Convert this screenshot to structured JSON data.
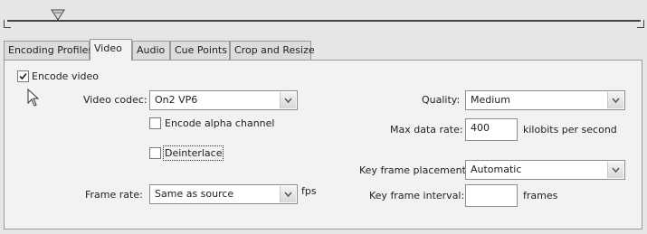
{
  "tabs": [
    {
      "label": "Encoding Profiles"
    },
    {
      "label": "Video"
    },
    {
      "label": "Audio"
    },
    {
      "label": "Cue Points"
    },
    {
      "label": "Crop and Resize"
    }
  ],
  "active_tab": "Video",
  "encode_video": {
    "label": "Encode video",
    "checked": true
  },
  "video_codec": {
    "label": "Video codec:",
    "value": "On2 VP6"
  },
  "encode_alpha": {
    "label": "Encode alpha channel",
    "checked": false
  },
  "deinterlace": {
    "label": "Deinterlace",
    "checked": false
  },
  "frame_rate": {
    "label": "Frame rate:",
    "value": "Same as source",
    "unit": "fps"
  },
  "quality": {
    "label": "Quality:",
    "value": "Medium"
  },
  "max_data_rate": {
    "label": "Max data rate:",
    "value": "400",
    "unit": "kilobits per second"
  },
  "key_frame_placement": {
    "label": "Key frame placement:",
    "value": "Automatic"
  },
  "key_frame_interval": {
    "label": "Key frame interval:",
    "value": "",
    "unit": "frames"
  },
  "icons": {
    "timeline_playhead": "playhead-triangle-icon",
    "cursor": "mouse-pointer-icon",
    "dropdown": "chevron-down-icon"
  }
}
